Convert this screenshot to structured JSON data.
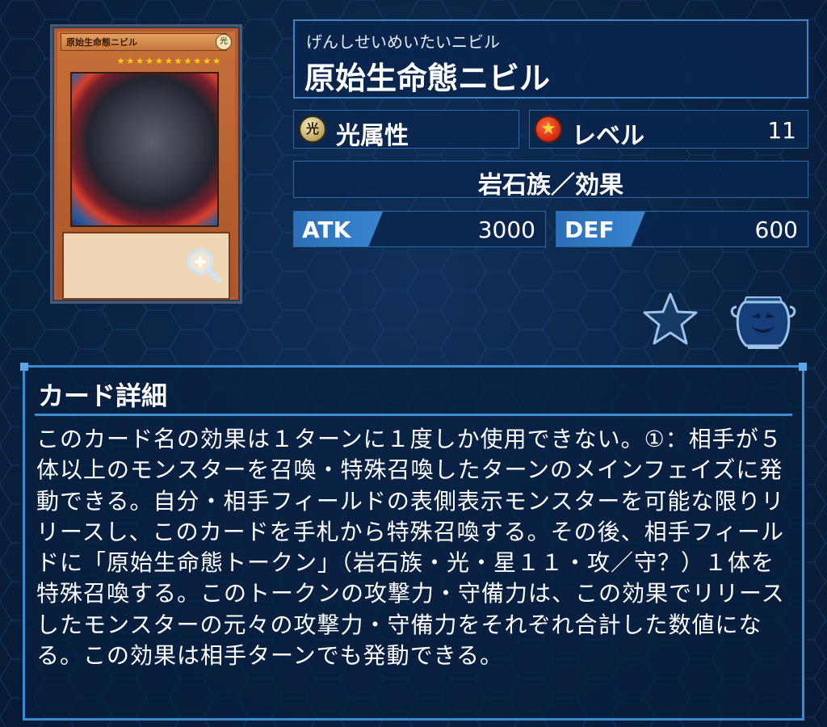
{
  "card": {
    "thumbnail_name": "原始生命態ニビル",
    "thumbnail_attr_glyph": "光",
    "thumbnail_stars": "★★★★★★★★★★★",
    "magnify_icon": "zoom-in-icon"
  },
  "info": {
    "reading": "げんしせいめいたいニビル",
    "name": "原始生命態ニビル",
    "attribute_glyph": "光",
    "attribute_label": "光属性",
    "level_label": "レベル",
    "level_value": "11",
    "type": "岩石族／効果",
    "atk_label": "ATK",
    "atk_value": "3000",
    "def_label": "DEF",
    "def_value": "600"
  },
  "actions": {
    "favorite_icon": "star-icon",
    "deck_icon": "pot-of-greed-icon"
  },
  "detail": {
    "title": "カード詳細",
    "text": "このカード名の効果は１ターンに１度しか使用できない。①：相手が５体以上のモンスターを召喚・特殊召喚したターンのメインフェイズに発動できる。自分・相手フィールドの表側表示モンスターを可能な限りリリースし、このカードを手札から特殊召喚する。その後、相手フィールドに「原始生命態トークン」（岩石族・光・星１１・攻／守？）１体を特殊召喚する。このトークンの攻撃力・守備力は、この効果でリリースしたモンスターの元々の攻撃力・守備力をそれぞれ合計した数値になる。この効果は相手ターンでも発動できる。"
  },
  "colors": {
    "background": "#0b2344",
    "panel_border": "#3c84c6",
    "stat_tag": "#3a84cf",
    "card_frame": "#b45a2e"
  }
}
